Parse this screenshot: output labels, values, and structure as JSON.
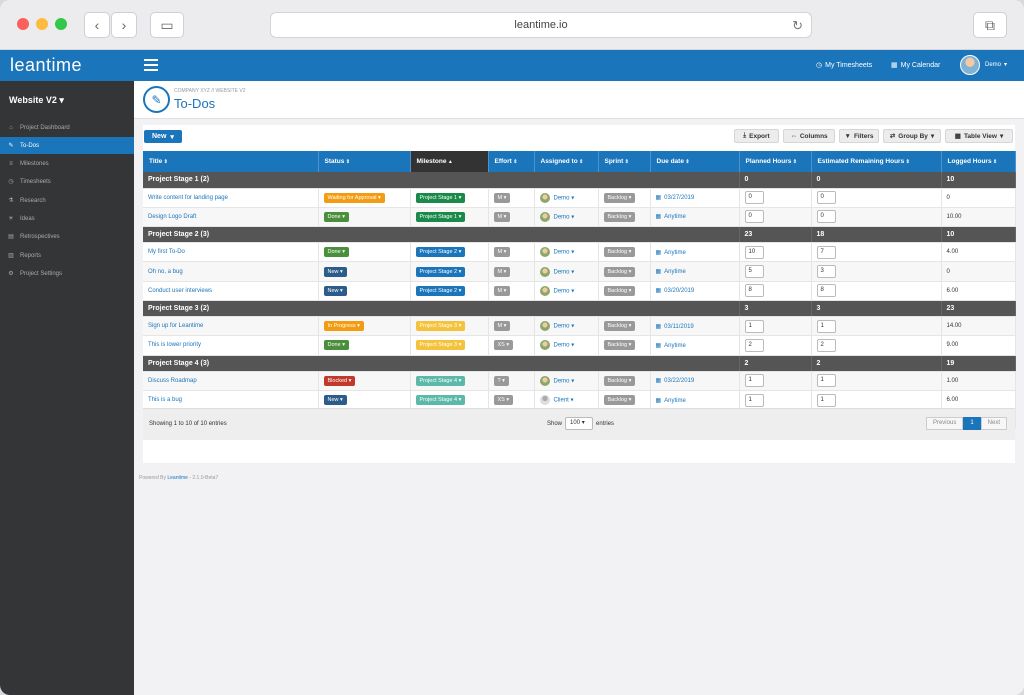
{
  "browser": {
    "url": "leantime.io"
  },
  "colors": {
    "accent": "#1b75bb",
    "waiting": "#f39c12",
    "done": "#4a8f3c",
    "new": "#2c5d8a",
    "in_progress": "#f39c12",
    "blocked": "#c0392b",
    "stage1": "#1a8a4a",
    "stage2": "#1b75bb",
    "stage3": "#f5c33b",
    "stage4": "#5cb8a8"
  },
  "topbar": {
    "logo": "leantime",
    "timesheets": "My Timesheets",
    "calendar": "My Calendar",
    "user": "Demo"
  },
  "sidebar": {
    "project": "Website V2",
    "items": [
      {
        "label": "Project Dashboard",
        "icon": "home-icon"
      },
      {
        "label": "To-Dos",
        "icon": "pin-icon"
      },
      {
        "label": "Milestones",
        "icon": "milestone-icon"
      },
      {
        "label": "Timesheets",
        "icon": "clock-icon"
      },
      {
        "label": "Research",
        "icon": "flask-icon"
      },
      {
        "label": "Ideas",
        "icon": "lightbulb-icon"
      },
      {
        "label": "Retrospectives",
        "icon": "retro-icon"
      },
      {
        "label": "Reports",
        "icon": "chart-icon"
      },
      {
        "label": "Project Settings",
        "icon": "gear-icon"
      }
    ]
  },
  "page": {
    "breadcrumb": "COMPANY XYZ // WEBSITE V2",
    "title": "To-Dos"
  },
  "toolbar": {
    "new": "New",
    "export": "Export",
    "columns": "Columns",
    "filters": "Filters",
    "group_by": "Group By",
    "table_view": "Table View"
  },
  "columns": [
    "Title",
    "Status",
    "Milestone",
    "Effort",
    "Assigned to",
    "Sprint",
    "Due date",
    "Planned Hours",
    "Estimated Remaining Hours",
    "Logged Hours"
  ],
  "groups": [
    {
      "name": "Project Stage 1 (2)",
      "planned": "0",
      "remaining": "0",
      "logged": "10",
      "rows": [
        {
          "title": "Write content for landing page",
          "status": "Waiting for Approval",
          "status_color": "#f39c12",
          "milestone": "Project Stage 1",
          "ms_color": "#1a8a4a",
          "effort": "M",
          "user": "Demo",
          "sprint": "Backlog",
          "due": "03/27/2019",
          "planned": "0",
          "remaining": "0",
          "logged": "0"
        },
        {
          "title": "Design Logo Draft",
          "status": "Done",
          "status_color": "#4a8f3c",
          "milestone": "Project Stage 1",
          "ms_color": "#1a8a4a",
          "effort": "M",
          "user": "Demo",
          "sprint": "Backlog",
          "due": "Anytime",
          "planned": "0",
          "remaining": "0",
          "logged": "10.00"
        }
      ]
    },
    {
      "name": "Project Stage 2 (3)",
      "planned": "23",
      "remaining": "18",
      "logged": "10",
      "rows": [
        {
          "title": "My first To-Do",
          "status": "Done",
          "status_color": "#4a8f3c",
          "milestone": "Project Stage 2",
          "ms_color": "#1b75bb",
          "effort": "M",
          "user": "Demo",
          "sprint": "Backlog",
          "due": "Anytime",
          "planned": "10",
          "remaining": "7",
          "logged": "4.00"
        },
        {
          "title": "Oh no, a bug",
          "status": "New",
          "status_color": "#2c5d8a",
          "milestone": "Project Stage 2",
          "ms_color": "#1b75bb",
          "effort": "M",
          "user": "Demo",
          "sprint": "Backlog",
          "due": "Anytime",
          "planned": "5",
          "remaining": "3",
          "logged": "0"
        },
        {
          "title": "Conduct user interviews",
          "status": "New",
          "status_color": "#2c5d8a",
          "milestone": "Project Stage 2",
          "ms_color": "#1b75bb",
          "effort": "M",
          "user": "Demo",
          "sprint": "Backlog",
          "due": "03/20/2019",
          "planned": "8",
          "remaining": "8",
          "logged": "6.00"
        }
      ]
    },
    {
      "name": "Project Stage 3 (2)",
      "planned": "3",
      "remaining": "3",
      "logged": "23",
      "rows": [
        {
          "title": "Sign up for Leantime",
          "status": "In Progress",
          "status_color": "#f39c12",
          "milestone": "Project Stage 3",
          "ms_color": "#f5c33b",
          "effort": "M",
          "user": "Demo",
          "sprint": "Backlog",
          "due": "03/11/2019",
          "planned": "1",
          "remaining": "1",
          "logged": "14.00"
        },
        {
          "title": "This is lower priority",
          "status": "Done",
          "status_color": "#4a8f3c",
          "milestone": "Project Stage 3",
          "ms_color": "#f5c33b",
          "effort": "XS",
          "user": "Demo",
          "sprint": "Backlog",
          "due": "Anytime",
          "planned": "2",
          "remaining": "2",
          "logged": "9.00"
        }
      ]
    },
    {
      "name": "Project Stage 4 (3)",
      "planned": "2",
      "remaining": "2",
      "logged": "19",
      "rows": [
        {
          "title": "Discuss Roadmap",
          "status": "Blocked",
          "status_color": "#c0392b",
          "milestone": "Project Stage 4",
          "ms_color": "#5cb8a8",
          "effort": "?",
          "user": "Demo",
          "sprint": "Backlog",
          "due": "03/22/2019",
          "planned": "1",
          "remaining": "1",
          "logged": "1.00"
        },
        {
          "title": "This is a bug",
          "status": "New",
          "status_color": "#2c5d8a",
          "milestone": "Project Stage 4",
          "ms_color": "#5cb8a8",
          "effort": "XS",
          "user": "Client",
          "sprint": "Backlog",
          "due": "Anytime",
          "planned": "1",
          "remaining": "1",
          "logged": "6.00"
        },
        {
          "title": "Design Landing Page",
          "status": "Waiting for Approval",
          "status_color": "#f39c12",
          "milestone": "Project Stage 4",
          "ms_color": "#5cb8a8",
          "effort": "?",
          "user": "Client",
          "sprint": "Backlog",
          "due": "03/28/2019",
          "planned": "0",
          "remaining": "0",
          "logged": "12.00"
        }
      ]
    }
  ],
  "footer": {
    "info": "Showing 1 to 10 of 10 entries",
    "show_label": "Show",
    "show_value": "100",
    "entries_label": "entries",
    "previous": "Previous",
    "page": "1",
    "next": "Next"
  },
  "powered": {
    "prefix": "Powered By",
    "brand": "Leantime",
    "version": "- 2.1.0-Beta7"
  }
}
